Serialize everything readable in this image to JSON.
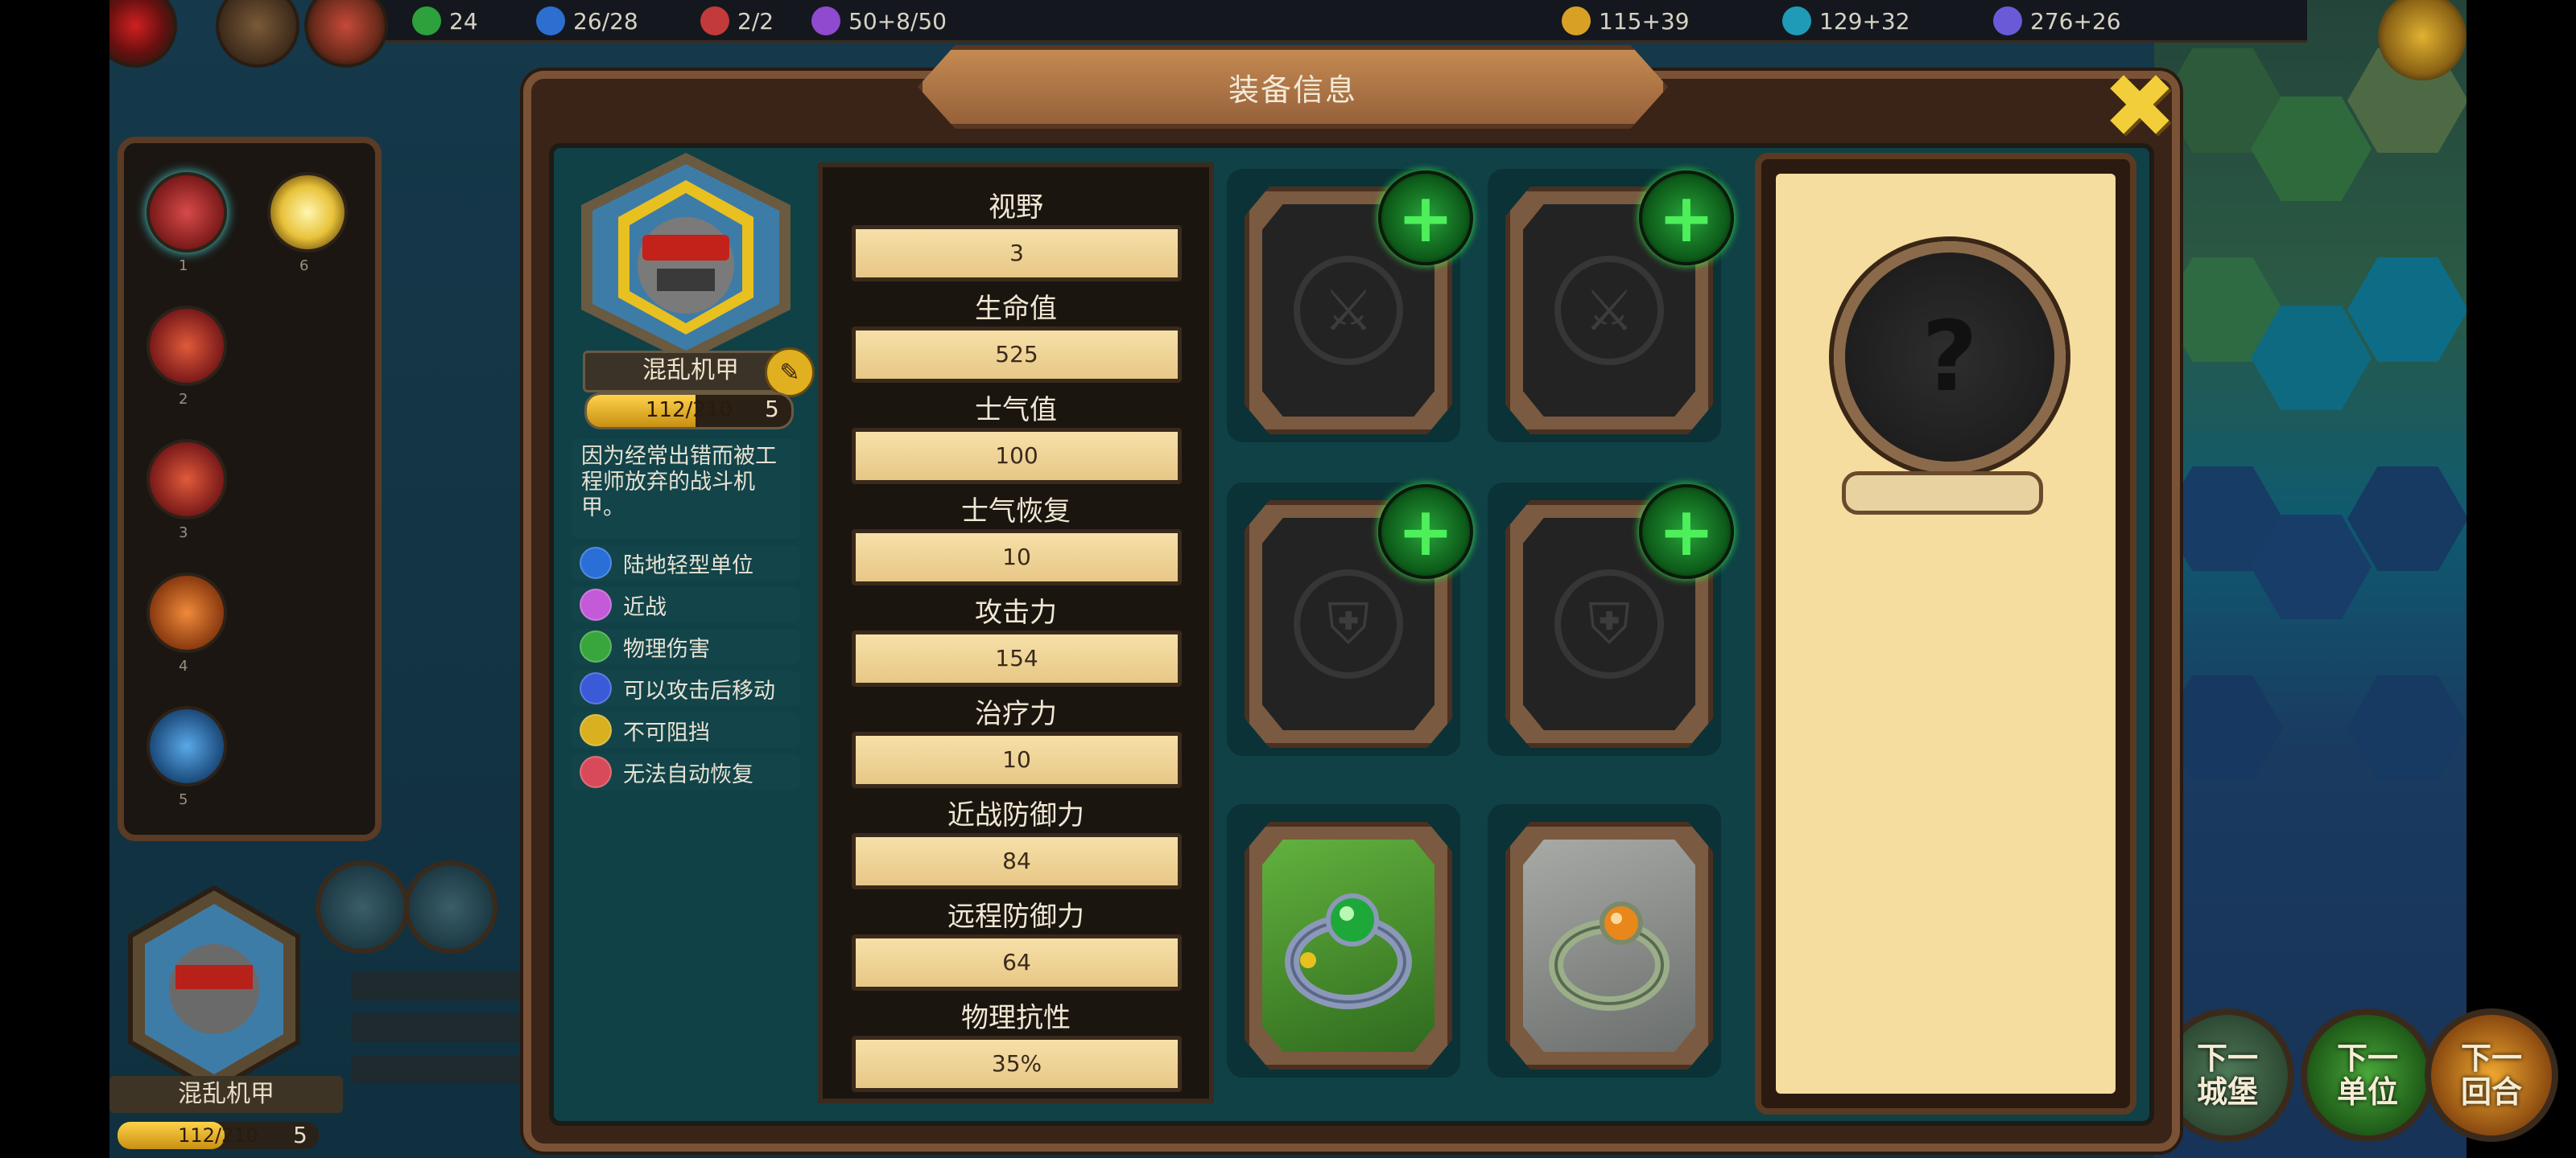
{
  "top_bar": {
    "resources": [
      {
        "icon": "population-icon",
        "value": "24",
        "color": "#2da13b"
      },
      {
        "icon": "unit-count-icon",
        "value": "26/28",
        "color": "#2c6fd0"
      },
      {
        "icon": "hero-icon",
        "value": "2/2",
        "color": "#c23a3a"
      },
      {
        "icon": "mana-icon",
        "value": "50+8/50",
        "color": "#8f4ad0"
      },
      {
        "icon": "gold-icon",
        "value": "115+39",
        "color": "#d8a126"
      },
      {
        "icon": "book-icon",
        "value": "129+32",
        "color": "#1f9bb8"
      },
      {
        "icon": "research-icon",
        "value": "276+26",
        "color": "#6a5ad8"
      }
    ]
  },
  "dialog": {
    "title": "装备信息",
    "close_icon": "close-x-icon"
  },
  "unit": {
    "name": "混乱机甲",
    "hp": "112/210",
    "hp_ratio": 0.533,
    "level": "5",
    "description": "因为经常出错而被工程师放弃的战斗机甲。",
    "traits": [
      {
        "label": "陆地轻型单位",
        "icon": "land-light-unit-icon",
        "color": "#2a6fd8"
      },
      {
        "label": "近战",
        "icon": "melee-icon",
        "color": "#c45ad8"
      },
      {
        "label": "物理伤害",
        "icon": "physical-damage-icon",
        "color": "#38a63c"
      },
      {
        "label": "可以攻击后移动",
        "icon": "move-after-attack-icon",
        "color": "#3a5ad8"
      },
      {
        "label": "不可阻挡",
        "icon": "unstoppable-icon",
        "color": "#d8b020"
      },
      {
        "label": "无法自动恢复",
        "icon": "no-regen-icon",
        "color": "#d84a5a"
      }
    ]
  },
  "stats": [
    {
      "label": "视野",
      "value": "3"
    },
    {
      "label": "生命值",
      "value": "525"
    },
    {
      "label": "士气值",
      "value": "100"
    },
    {
      "label": "士气恢复",
      "value": "10"
    },
    {
      "label": "攻击力",
      "value": "154"
    },
    {
      "label": "治疗力",
      "value": "10"
    },
    {
      "label": "近战防御力",
      "value": "84"
    },
    {
      "label": "远程防御力",
      "value": "64"
    },
    {
      "label": "物理抗性",
      "value": "35%"
    }
  ],
  "equipment_slots": [
    {
      "type": "weapon",
      "icon": "sword-slot-icon",
      "empty": true
    },
    {
      "type": "weapon",
      "icon": "sword-slot-icon",
      "empty": true
    },
    {
      "type": "armor",
      "icon": "armor-slot-icon",
      "empty": true
    },
    {
      "type": "armor",
      "icon": "armor-slot-icon",
      "empty": true
    },
    {
      "type": "ring",
      "icon": "green-gem-ring-icon",
      "empty": false,
      "bg": "#3f8a2a"
    },
    {
      "type": "ring",
      "icon": "orange-gem-ring-icon",
      "empty": false,
      "bg": "#8a8e8c"
    }
  ],
  "left_panel": {
    "skills": [
      {
        "num": "1",
        "icon": "sword-skill-icon",
        "color": "#b33a3a"
      },
      {
        "num": "6",
        "icon": "sun-skill-icon",
        "color": "#e8c23a"
      },
      {
        "num": "2",
        "icon": "wind-skill-icon",
        "color": "#c0392b"
      },
      {
        "num": "3",
        "icon": "spear-skill-icon",
        "color": "#c0392b"
      },
      {
        "num": "4",
        "icon": "tools-skill-icon",
        "color": "#d9682a"
      },
      {
        "num": "5",
        "icon": "figure-skill-icon",
        "color": "#2b78b8"
      }
    ],
    "unit_name": "混乱机甲",
    "unit_hp": "112/210",
    "unit_level": "5"
  },
  "next_buttons": [
    {
      "label": "下一\n城堡",
      "color": "#3e6a48"
    },
    {
      "label": "下一\n单位",
      "color": "#3a8a2a"
    },
    {
      "label": "下一\n回合",
      "color": "#d48a20"
    }
  ]
}
